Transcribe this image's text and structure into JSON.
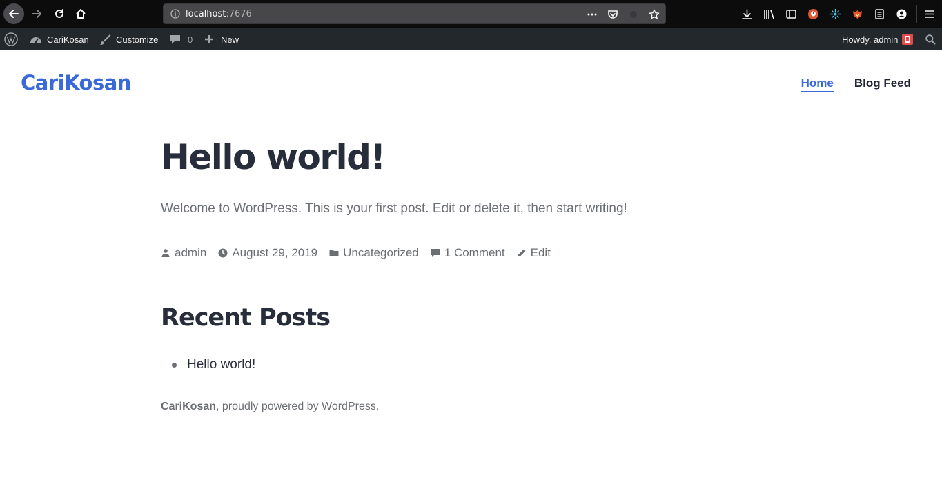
{
  "browser": {
    "url_host": "localhost",
    "url_port": ":7676"
  },
  "admin_bar": {
    "site_name": "CariKosan",
    "customize": "Customize",
    "comments_count": "0",
    "new": "New",
    "howdy": "Howdy, admin"
  },
  "site": {
    "title": "CariKosan",
    "nav": [
      {
        "label": "Home",
        "current": true
      },
      {
        "label": "Blog Feed",
        "current": false
      }
    ]
  },
  "post": {
    "title": "Hello world!",
    "excerpt": "Welcome to WordPress. This is your first post. Edit or delete it, then start writing!",
    "meta": {
      "author": "admin",
      "date": "August 29, 2019",
      "category": "Uncategorized",
      "comments": "1 Comment",
      "edit": "Edit"
    }
  },
  "widget": {
    "title": "Recent Posts",
    "items": [
      "Hello world!"
    ]
  },
  "footer": {
    "site_name": "CariKosan",
    "powered": ", proudly powered by WordPress."
  },
  "colors": {
    "accent": "#3a6ad9",
    "heading": "#272d3a",
    "text_muted": "#6b6e73",
    "admin_bar_bg": "#23282d",
    "browser_bg": "#0c0c0d"
  }
}
